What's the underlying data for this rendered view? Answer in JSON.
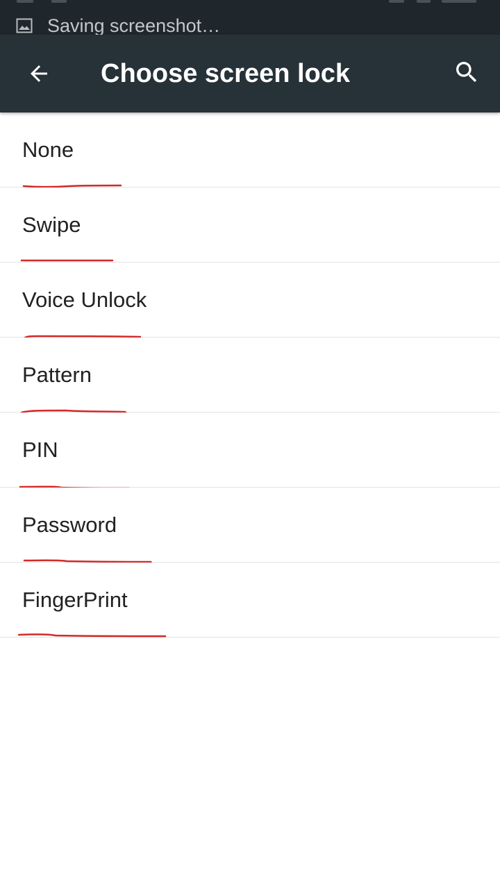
{
  "notification": {
    "icon": "image-icon",
    "text": "Saving screenshot…"
  },
  "appbar": {
    "back_icon": "arrow-back-icon",
    "title": "Choose screen lock",
    "search_icon": "search-icon",
    "color": "#263238"
  },
  "options": [
    {
      "label": "None"
    },
    {
      "label": "Swipe"
    },
    {
      "label": "Voice Unlock"
    },
    {
      "label": "Pattern"
    },
    {
      "label": "PIN"
    },
    {
      "label": "Password"
    },
    {
      "label": "FingerPrint"
    }
  ],
  "annotation_color": "#d12a2a"
}
